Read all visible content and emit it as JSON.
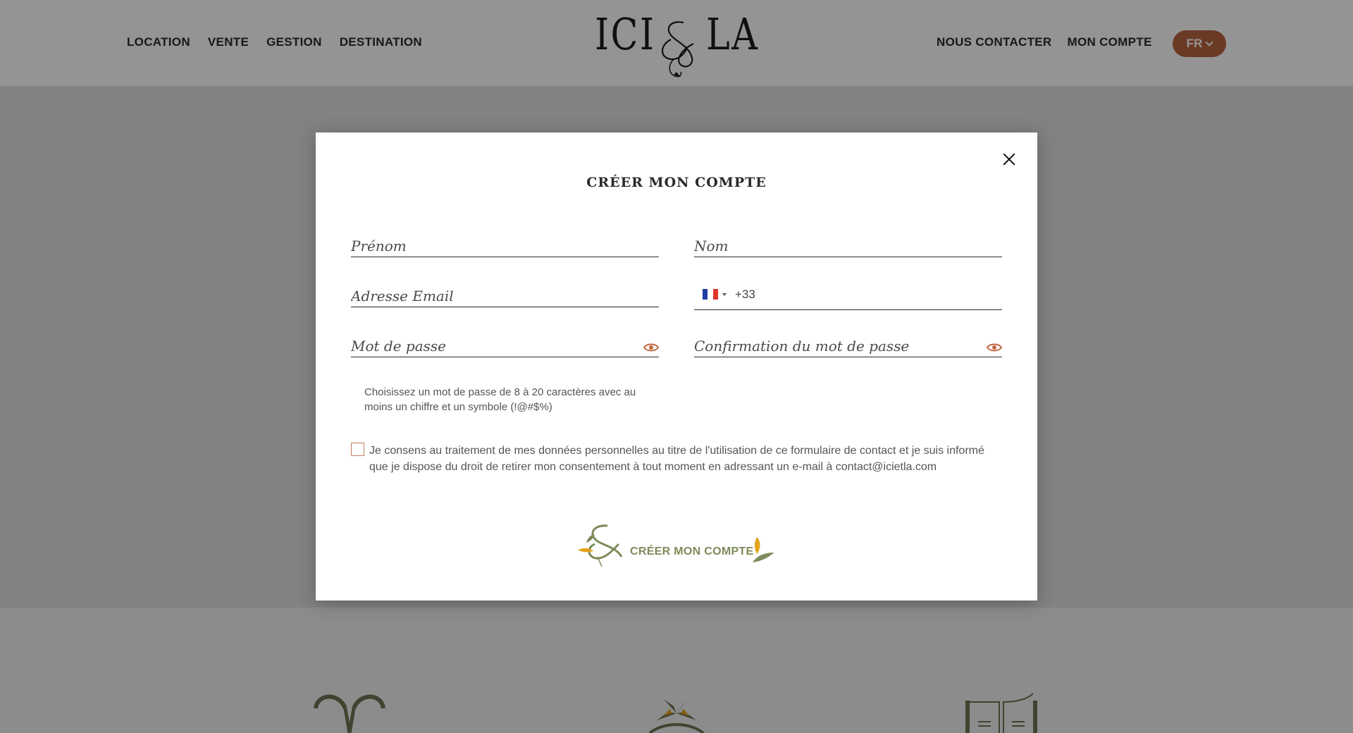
{
  "header": {
    "nav_left": [
      "LOCATION",
      "VENTE",
      "GESTION",
      "DESTINATION"
    ],
    "nav_right": [
      "NOUS CONTACTER",
      "MON COMPTE"
    ],
    "logo": {
      "left": "ICI",
      "right": "LA"
    },
    "language": "FR"
  },
  "modal": {
    "title": "CRÉER MON COMPTE",
    "fields": {
      "first_name_placeholder": "Prénom",
      "last_name_placeholder": "Nom",
      "email_placeholder": "Adresse Email",
      "phone_code": "+33",
      "password_placeholder": "Mot de passe",
      "password_confirm_placeholder": "Confirmation du mot de passe"
    },
    "password_hint": "Choisissez un mot de passe de 8 à 20 caractères avec au moins un chiffre et un symbole (!@#$%)",
    "consent_text": "Je consens au traitement de mes données personnelles au titre de l'utilisation de ce formulaire de contact et je suis informé que je dispose du droit de retirer mon consentement à tout moment en adressant un e-mail à contact@icietla.com",
    "submit_label": "CRÉER MON COMPTE"
  },
  "colors": {
    "accent": "#b8643e",
    "olive": "#7d8b5a",
    "gold": "#e3a21a"
  },
  "icons": {
    "close": "close-icon",
    "eye": "eye-icon",
    "flag": "flag-fr-icon",
    "chevron": "chevron-down-icon"
  }
}
